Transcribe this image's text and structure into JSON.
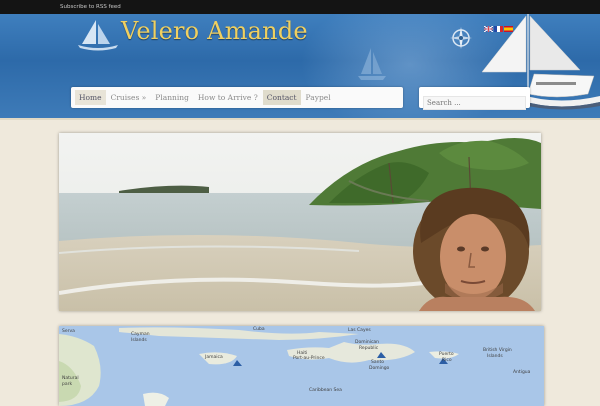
{
  "topbar": {
    "rss_text": "Subscribe to RSS feed"
  },
  "header": {
    "site_title": "Velero Amande"
  },
  "nav": {
    "items": [
      {
        "label": "Home"
      },
      {
        "label": "Cruises »"
      },
      {
        "label": "Planning"
      },
      {
        "label": "How to Arrive ?"
      },
      {
        "label": "Contact"
      },
      {
        "label": "Paypel"
      }
    ]
  },
  "search": {
    "placeholder": "Search ..."
  },
  "languages": [
    "english-flag",
    "french-flag",
    "spanish-flag"
  ],
  "map": {
    "labels": [
      "Serva",
      "Cayman",
      "Islands",
      "Cuba",
      "Las Cayes",
      "Jamaica",
      "Haiti",
      "Dominican",
      "Republic",
      "Puerto",
      "Rico",
      "British Virgin",
      "Islands",
      "Antigua",
      "Santo",
      "Domingo",
      "Port-au-Prince",
      "Caribbean Sea",
      "Natural",
      "park"
    ]
  },
  "colors": {
    "accent_title": "#f0d060",
    "header_blue": "#3f7fbe",
    "page_bg": "#efe9dc"
  }
}
